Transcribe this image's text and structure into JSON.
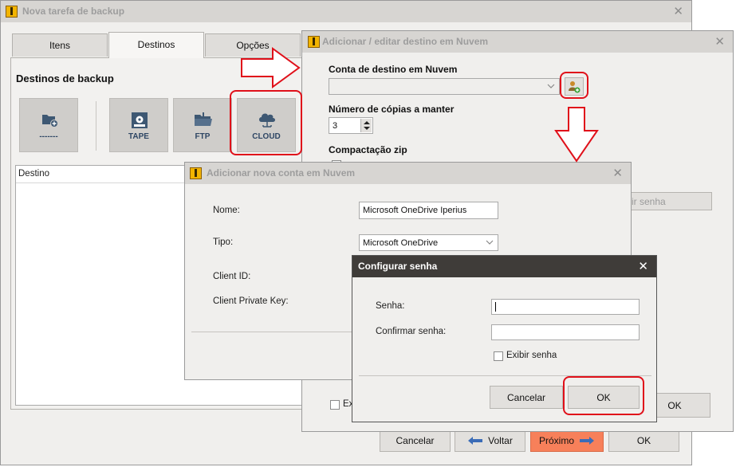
{
  "main_window": {
    "title": "Nova tarefa de backup",
    "tabs": [
      "Itens",
      "Destinos",
      "Opções"
    ],
    "section_title": "Destinos de backup",
    "destination_tiles": [
      {
        "label": "-------",
        "icon": "folder-add-icon"
      },
      {
        "label": "TAPE",
        "icon": "tape-icon"
      },
      {
        "label": "FTP",
        "icon": "ftp-folder-icon"
      },
      {
        "label": "CLOUD",
        "icon": "cloud-icon"
      }
    ],
    "list_column": "Destino",
    "buttons": {
      "cancel": "Cancelar",
      "back": "Voltar",
      "next": "Próximo",
      "ok": "OK"
    }
  },
  "cloud_destination_dialog": {
    "title": "Adicionar / editar destino em Nuvem",
    "account_label": "Conta de destino em Nuvem",
    "account_value": "",
    "copies_label": "Número de cópias a manter",
    "copies_value": "3",
    "zip_label": "Compactação zip",
    "password_button_partial": "ir senha",
    "checkbox_partial": "Ex",
    "ok": "OK"
  },
  "new_account_dialog": {
    "title": "Adicionar nova conta em Nuvem",
    "name_label": "Nome:",
    "name_value": "Microsoft OneDrive Iperius",
    "type_label": "Tipo:",
    "type_value": "Microsoft OneDrive",
    "client_id_label": "Client ID:",
    "client_key_label": "Client Private Key:"
  },
  "password_dialog": {
    "title": "Configurar senha",
    "password_label": "Senha:",
    "confirm_label": "Confirmar senha:",
    "show_password_label": "Exibir senha",
    "cancel": "Cancelar",
    "ok": "OK"
  },
  "colors": {
    "highlight": "#e0101a",
    "next_button": "#f7805a",
    "dark_titlebar": "#3f3c39"
  }
}
